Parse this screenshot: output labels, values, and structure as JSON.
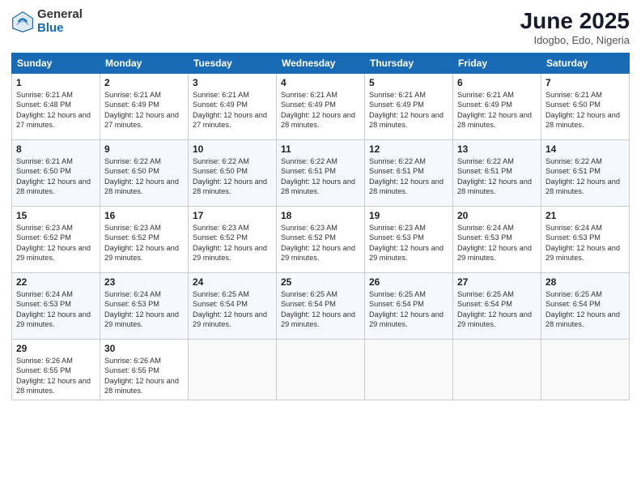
{
  "header": {
    "logo_general": "General",
    "logo_blue": "Blue",
    "month_title": "June 2025",
    "location": "Idogbo, Edo, Nigeria"
  },
  "days_of_week": [
    "Sunday",
    "Monday",
    "Tuesday",
    "Wednesday",
    "Thursday",
    "Friday",
    "Saturday"
  ],
  "weeks": [
    [
      {
        "day": "1",
        "sunrise": "6:21 AM",
        "sunset": "6:48 PM",
        "daylight": "12 hours and 27 minutes."
      },
      {
        "day": "2",
        "sunrise": "6:21 AM",
        "sunset": "6:49 PM",
        "daylight": "12 hours and 27 minutes."
      },
      {
        "day": "3",
        "sunrise": "6:21 AM",
        "sunset": "6:49 PM",
        "daylight": "12 hours and 27 minutes."
      },
      {
        "day": "4",
        "sunrise": "6:21 AM",
        "sunset": "6:49 PM",
        "daylight": "12 hours and 28 minutes."
      },
      {
        "day": "5",
        "sunrise": "6:21 AM",
        "sunset": "6:49 PM",
        "daylight": "12 hours and 28 minutes."
      },
      {
        "day": "6",
        "sunrise": "6:21 AM",
        "sunset": "6:49 PM",
        "daylight": "12 hours and 28 minutes."
      },
      {
        "day": "7",
        "sunrise": "6:21 AM",
        "sunset": "6:50 PM",
        "daylight": "12 hours and 28 minutes."
      }
    ],
    [
      {
        "day": "8",
        "sunrise": "6:21 AM",
        "sunset": "6:50 PM",
        "daylight": "12 hours and 28 minutes."
      },
      {
        "day": "9",
        "sunrise": "6:22 AM",
        "sunset": "6:50 PM",
        "daylight": "12 hours and 28 minutes."
      },
      {
        "day": "10",
        "sunrise": "6:22 AM",
        "sunset": "6:50 PM",
        "daylight": "12 hours and 28 minutes."
      },
      {
        "day": "11",
        "sunrise": "6:22 AM",
        "sunset": "6:51 PM",
        "daylight": "12 hours and 28 minutes."
      },
      {
        "day": "12",
        "sunrise": "6:22 AM",
        "sunset": "6:51 PM",
        "daylight": "12 hours and 28 minutes."
      },
      {
        "day": "13",
        "sunrise": "6:22 AM",
        "sunset": "6:51 PM",
        "daylight": "12 hours and 28 minutes."
      },
      {
        "day": "14",
        "sunrise": "6:22 AM",
        "sunset": "6:51 PM",
        "daylight": "12 hours and 28 minutes."
      }
    ],
    [
      {
        "day": "15",
        "sunrise": "6:23 AM",
        "sunset": "6:52 PM",
        "daylight": "12 hours and 29 minutes."
      },
      {
        "day": "16",
        "sunrise": "6:23 AM",
        "sunset": "6:52 PM",
        "daylight": "12 hours and 29 minutes."
      },
      {
        "day": "17",
        "sunrise": "6:23 AM",
        "sunset": "6:52 PM",
        "daylight": "12 hours and 29 minutes."
      },
      {
        "day": "18",
        "sunrise": "6:23 AM",
        "sunset": "6:52 PM",
        "daylight": "12 hours and 29 minutes."
      },
      {
        "day": "19",
        "sunrise": "6:23 AM",
        "sunset": "6:53 PM",
        "daylight": "12 hours and 29 minutes."
      },
      {
        "day": "20",
        "sunrise": "6:24 AM",
        "sunset": "6:53 PM",
        "daylight": "12 hours and 29 minutes."
      },
      {
        "day": "21",
        "sunrise": "6:24 AM",
        "sunset": "6:53 PM",
        "daylight": "12 hours and 29 minutes."
      }
    ],
    [
      {
        "day": "22",
        "sunrise": "6:24 AM",
        "sunset": "6:53 PM",
        "daylight": "12 hours and 29 minutes."
      },
      {
        "day": "23",
        "sunrise": "6:24 AM",
        "sunset": "6:53 PM",
        "daylight": "12 hours and 29 minutes."
      },
      {
        "day": "24",
        "sunrise": "6:25 AM",
        "sunset": "6:54 PM",
        "daylight": "12 hours and 29 minutes."
      },
      {
        "day": "25",
        "sunrise": "6:25 AM",
        "sunset": "6:54 PM",
        "daylight": "12 hours and 29 minutes."
      },
      {
        "day": "26",
        "sunrise": "6:25 AM",
        "sunset": "6:54 PM",
        "daylight": "12 hours and 29 minutes."
      },
      {
        "day": "27",
        "sunrise": "6:25 AM",
        "sunset": "6:54 PM",
        "daylight": "12 hours and 29 minutes."
      },
      {
        "day": "28",
        "sunrise": "6:25 AM",
        "sunset": "6:54 PM",
        "daylight": "12 hours and 28 minutes."
      }
    ],
    [
      {
        "day": "29",
        "sunrise": "6:26 AM",
        "sunset": "6:55 PM",
        "daylight": "12 hours and 28 minutes."
      },
      {
        "day": "30",
        "sunrise": "6:26 AM",
        "sunset": "6:55 PM",
        "daylight": "12 hours and 28 minutes."
      },
      null,
      null,
      null,
      null,
      null
    ]
  ],
  "labels": {
    "sunrise_prefix": "Sunrise: ",
    "sunset_prefix": "Sunset: ",
    "daylight_prefix": "Daylight: "
  }
}
